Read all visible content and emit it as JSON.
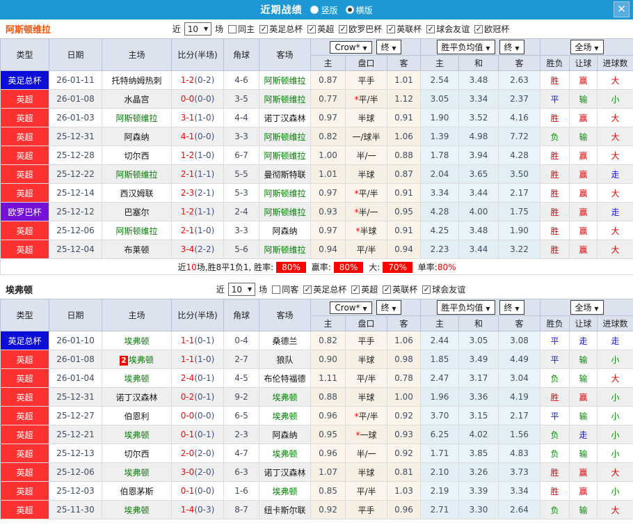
{
  "titlebar": {
    "title": "近期战绩",
    "options": [
      {
        "label": "竖版",
        "checked": false
      },
      {
        "label": "横版",
        "checked": true
      }
    ]
  },
  "icons": {
    "close": "✕",
    "caret": "▼",
    "check": "✓"
  },
  "table_header": {
    "type": "类型",
    "date": "日期",
    "home": "主场",
    "score": "比分(半场)",
    "corner": "角球",
    "away": "客场",
    "dd_crow": "Crow*",
    "dd_final1": "终",
    "dd_mean": "胜平负均值",
    "dd_final2": "终",
    "dd_scope": "全场",
    "sub": [
      "主",
      "盘口",
      "客",
      "主",
      "和",
      "客",
      "胜负",
      "让球",
      "进球数"
    ]
  },
  "league_colors": {
    "英足总杯": "#0d0dd8",
    "英超": "#ff3232",
    "欧罗巴杯": "#7311d9"
  },
  "result_colors": {
    "胜": "#e60000",
    "赢": "#e60000",
    "大": "#e60000",
    "平": "#1414dd",
    "走": "#1414dd",
    "负": "#009600",
    "输": "#009600",
    "小": "#009600"
  },
  "score_color": "#ff0000",
  "sections": [
    {
      "team": "阿斯顿维拉",
      "team_color": "#ff5000",
      "filter": {
        "prefix": "近",
        "count": "10",
        "suffix": "场",
        "same_label": "同主",
        "same_checked": false,
        "leagues": [
          "英足总杯",
          "英超",
          "欧罗巴杯",
          "英联杯",
          "球会友谊",
          "欧冠杯"
        ]
      },
      "rows": [
        {
          "league": "英足总杯",
          "date": "26-01-11",
          "home": {
            "name": "托特纳姆热刺",
            "green": false
          },
          "score": "1-2",
          "half": "(0-2)",
          "corner": "4-6",
          "away": {
            "name": "阿斯顿维拉",
            "green": true
          },
          "o1": "0.87",
          "hcap": "平手",
          "o2": "1.01",
          "m1": "2.54",
          "m2": "3.48",
          "m3": "2.63",
          "r": [
            "胜",
            "赢",
            "大"
          ]
        },
        {
          "league": "英超",
          "date": "26-01-08",
          "home": {
            "name": "水晶宫",
            "green": false
          },
          "score": "0-0",
          "half": "(0-0)",
          "corner": "3-5",
          "away": {
            "name": "阿斯顿维拉",
            "green": true
          },
          "o1": "0.77",
          "hcap": "*平/半",
          "o2": "1.12",
          "m1": "3.05",
          "m2": "3.34",
          "m3": "2.37",
          "r": [
            "平",
            "输",
            "小"
          ]
        },
        {
          "league": "英超",
          "date": "26-01-03",
          "home": {
            "name": "阿斯顿维拉",
            "green": true
          },
          "score": "3-1",
          "half": "(1-0)",
          "corner": "4-4",
          "away": {
            "name": "诺丁汉森林",
            "green": false
          },
          "o1": "0.97",
          "hcap": "半球",
          "o2": "0.91",
          "m1": "1.90",
          "m2": "3.52",
          "m3": "4.16",
          "r": [
            "胜",
            "赢",
            "大"
          ]
        },
        {
          "league": "英超",
          "date": "25-12-31",
          "home": {
            "name": "阿森纳",
            "green": false
          },
          "score": "4-1",
          "half": "(0-0)",
          "corner": "3-3",
          "away": {
            "name": "阿斯顿维拉",
            "green": true
          },
          "o1": "0.82",
          "hcap": "一/球半",
          "o2": "1.06",
          "m1": "1.39",
          "m2": "4.98",
          "m3": "7.72",
          "r": [
            "负",
            "输",
            "大"
          ]
        },
        {
          "league": "英超",
          "date": "25-12-28",
          "home": {
            "name": "切尔西",
            "green": false
          },
          "score": "1-2",
          "half": "(1-0)",
          "corner": "6-7",
          "away": {
            "name": "阿斯顿维拉",
            "green": true
          },
          "o1": "1.00",
          "hcap": "半/一",
          "o2": "0.88",
          "m1": "1.78",
          "m2": "3.94",
          "m3": "4.28",
          "r": [
            "胜",
            "赢",
            "大"
          ]
        },
        {
          "league": "英超",
          "date": "25-12-22",
          "home": {
            "name": "阿斯顿维拉",
            "green": true
          },
          "score": "2-1",
          "half": "(1-1)",
          "corner": "5-5",
          "away": {
            "name": "曼彻斯特联",
            "green": false
          },
          "o1": "1.01",
          "hcap": "半球",
          "o2": "0.87",
          "m1": "2.04",
          "m2": "3.65",
          "m3": "3.50",
          "r": [
            "胜",
            "赢",
            "走"
          ]
        },
        {
          "league": "英超",
          "date": "25-12-14",
          "home": {
            "name": "西汉姆联",
            "green": false
          },
          "score": "2-3",
          "half": "(2-1)",
          "corner": "5-3",
          "away": {
            "name": "阿斯顿维拉",
            "green": true
          },
          "o1": "0.97",
          "hcap": "*平/半",
          "o2": "0.91",
          "m1": "3.34",
          "m2": "3.44",
          "m3": "2.17",
          "r": [
            "胜",
            "赢",
            "大"
          ]
        },
        {
          "league": "欧罗巴杯",
          "date": "25-12-12",
          "home": {
            "name": "巴塞尔",
            "green": false
          },
          "score": "1-2",
          "half": "(1-1)",
          "corner": "2-4",
          "away": {
            "name": "阿斯顿维拉",
            "green": true
          },
          "o1": "0.93",
          "hcap": "*半/一",
          "o2": "0.95",
          "m1": "4.28",
          "m2": "4.00",
          "m3": "1.75",
          "r": [
            "胜",
            "赢",
            "走"
          ]
        },
        {
          "league": "英超",
          "date": "25-12-06",
          "home": {
            "name": "阿斯顿维拉",
            "green": true
          },
          "score": "2-1",
          "half": "(1-0)",
          "corner": "3-3",
          "away": {
            "name": "阿森纳",
            "green": false
          },
          "o1": "0.97",
          "hcap": "*半球",
          "o2": "0.91",
          "m1": "4.25",
          "m2": "3.48",
          "m3": "1.90",
          "r": [
            "胜",
            "赢",
            "大"
          ]
        },
        {
          "league": "英超",
          "date": "25-12-04",
          "home": {
            "name": "布莱顿",
            "green": false
          },
          "score": "3-4",
          "half": "(2-2)",
          "corner": "5-6",
          "away": {
            "name": "阿斯顿维拉",
            "green": true
          },
          "o1": "0.94",
          "hcap": "平/半",
          "o2": "0.94",
          "m1": "2.23",
          "m2": "3.44",
          "m3": "3.22",
          "r": [
            "胜",
            "赢",
            "大"
          ]
        }
      ],
      "summary": [
        {
          "t": "近"
        },
        {
          "t": "10",
          "red": true
        },
        {
          "t": "场,胜8平1负1, 胜率:"
        },
        {
          "t": "80%",
          "badge": true
        },
        {
          "t": " 赢率:"
        },
        {
          "t": "80%",
          "badge": true
        },
        {
          "t": " 大:"
        },
        {
          "t": "70%",
          "badge": true
        },
        {
          "t": " 单率:"
        },
        {
          "t": "80%",
          "red": true
        }
      ]
    },
    {
      "team": "埃弗顿",
      "team_color": "#1a1a1a",
      "filter": {
        "prefix": "近",
        "count": "10",
        "suffix": "场",
        "same_label": "同客",
        "same_checked": false,
        "leagues": [
          "英足总杯",
          "英超",
          "英联杯",
          "球会友谊"
        ]
      },
      "rows": [
        {
          "league": "英足总杯",
          "date": "26-01-10",
          "home": {
            "name": "埃弗顿",
            "green": true
          },
          "score": "1-1",
          "half": "(0-1)",
          "corner": "0-4",
          "away": {
            "name": "桑德兰",
            "green": false
          },
          "o1": "0.82",
          "hcap": "平手",
          "o2": "1.06",
          "m1": "2.44",
          "m2": "3.05",
          "m3": "3.08",
          "r": [
            "平",
            "走",
            "走"
          ]
        },
        {
          "league": "英超",
          "date": "26-01-08",
          "home": {
            "name": "埃弗顿",
            "green": true,
            "badge": "2"
          },
          "score": "1-1",
          "half": "(1-0)",
          "corner": "2-7",
          "away": {
            "name": "狼队",
            "green": false
          },
          "o1": "0.90",
          "hcap": "半球",
          "o2": "0.98",
          "m1": "1.85",
          "m2": "3.49",
          "m3": "4.49",
          "r": [
            "平",
            "输",
            "小"
          ]
        },
        {
          "league": "英超",
          "date": "26-01-04",
          "home": {
            "name": "埃弗顿",
            "green": true
          },
          "score": "2-4",
          "half": "(0-1)",
          "corner": "4-5",
          "away": {
            "name": "布伦特福德",
            "green": false
          },
          "o1": "1.11",
          "hcap": "平/半",
          "o2": "0.78",
          "m1": "2.47",
          "m2": "3.17",
          "m3": "3.04",
          "r": [
            "负",
            "输",
            "大"
          ]
        },
        {
          "league": "英超",
          "date": "25-12-31",
          "home": {
            "name": "诺丁汉森林",
            "green": false
          },
          "score": "0-2",
          "half": "(0-1)",
          "corner": "9-2",
          "away": {
            "name": "埃弗顿",
            "green": true
          },
          "o1": "0.88",
          "hcap": "半球",
          "o2": "1.00",
          "m1": "1.96",
          "m2": "3.36",
          "m3": "4.19",
          "r": [
            "胜",
            "赢",
            "小"
          ]
        },
        {
          "league": "英超",
          "date": "25-12-27",
          "home": {
            "name": "伯恩利",
            "green": false
          },
          "score": "0-0",
          "half": "(0-0)",
          "corner": "6-5",
          "away": {
            "name": "埃弗顿",
            "green": true
          },
          "o1": "0.96",
          "hcap": "*平/半",
          "o2": "0.92",
          "m1": "3.70",
          "m2": "3.15",
          "m3": "2.17",
          "r": [
            "平",
            "输",
            "小"
          ]
        },
        {
          "league": "英超",
          "date": "25-12-21",
          "home": {
            "name": "埃弗顿",
            "green": true
          },
          "score": "0-1",
          "half": "(0-1)",
          "corner": "2-3",
          "away": {
            "name": "阿森纳",
            "green": false
          },
          "o1": "0.95",
          "hcap": "*一球",
          "o2": "0.93",
          "m1": "6.25",
          "m2": "4.02",
          "m3": "1.56",
          "r": [
            "负",
            "走",
            "小"
          ]
        },
        {
          "league": "英超",
          "date": "25-12-13",
          "home": {
            "name": "切尔西",
            "green": false
          },
          "score": "2-0",
          "half": "(2-0)",
          "corner": "4-7",
          "away": {
            "name": "埃弗顿",
            "green": true
          },
          "o1": "0.96",
          "hcap": "半/一",
          "o2": "0.92",
          "m1": "1.71",
          "m2": "3.85",
          "m3": "4.83",
          "r": [
            "负",
            "输",
            "小"
          ]
        },
        {
          "league": "英超",
          "date": "25-12-06",
          "home": {
            "name": "埃弗顿",
            "green": true
          },
          "score": "3-0",
          "half": "(2-0)",
          "corner": "6-3",
          "away": {
            "name": "诺丁汉森林",
            "green": false
          },
          "o1": "1.07",
          "hcap": "半球",
          "o2": "0.81",
          "m1": "2.10",
          "m2": "3.26",
          "m3": "3.73",
          "r": [
            "胜",
            "赢",
            "大"
          ]
        },
        {
          "league": "英超",
          "date": "25-12-03",
          "home": {
            "name": "伯恩茅斯",
            "green": false
          },
          "score": "0-1",
          "half": "(0-0)",
          "corner": "1-6",
          "away": {
            "name": "埃弗顿",
            "green": true
          },
          "o1": "0.85",
          "hcap": "平/半",
          "o2": "1.03",
          "m1": "2.19",
          "m2": "3.39",
          "m3": "3.34",
          "r": [
            "胜",
            "赢",
            "小"
          ]
        },
        {
          "league": "英超",
          "date": "25-11-30",
          "home": {
            "name": "埃弗顿",
            "green": true
          },
          "score": "1-4",
          "half": "(0-3)",
          "corner": "8-7",
          "away": {
            "name": "纽卡斯尔联",
            "green": false
          },
          "o1": "0.92",
          "hcap": "平手",
          "o2": "0.96",
          "m1": "2.71",
          "m2": "3.30",
          "m3": "2.64",
          "r": [
            "负",
            "输",
            "大"
          ]
        }
      ],
      "summary": null
    }
  ]
}
